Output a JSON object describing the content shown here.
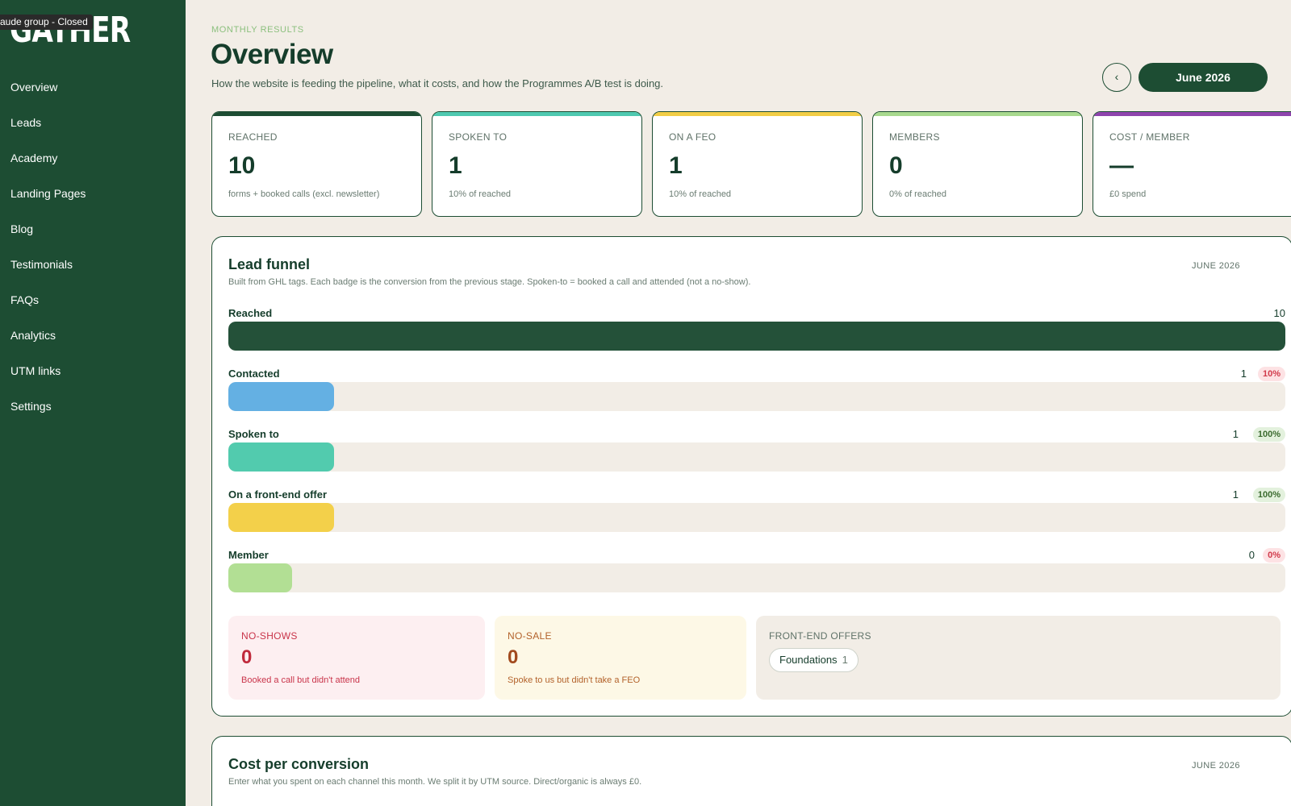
{
  "sidebar": {
    "logo": "GATHER",
    "tooltip": "aude group - Closed",
    "items": [
      "Overview",
      "Leads",
      "Academy",
      "Landing Pages",
      "Blog",
      "Testimonials",
      "FAQs",
      "Analytics",
      "UTM links",
      "Settings"
    ]
  },
  "header": {
    "eyebrow": "MONTHLY RESULTS",
    "title": "Overview",
    "subtitle": "How the website is feeding the pipeline, what it costs, and how the Programmes A/B test is doing.",
    "month": "June 2026",
    "prev_icon": "‹",
    "next_icon": "›"
  },
  "stats": [
    {
      "label": "REACHED",
      "value": "10",
      "note": "forms + booked calls (excl. newsletter)",
      "color": "#1d4d33"
    },
    {
      "label": "SPOKEN TO",
      "value": "1",
      "note": "10% of reached",
      "color": "#4fc9b0"
    },
    {
      "label": "ON A FEO",
      "value": "1",
      "note": "10% of reached",
      "color": "#f2cd46"
    },
    {
      "label": "MEMBERS",
      "value": "0",
      "note": "0% of reached",
      "color": "#a8d98e"
    },
    {
      "label": "COST / MEMBER",
      "value": "—",
      "note": "£0 spend",
      "color": "#8e44ad"
    }
  ],
  "funnel": {
    "title": "Lead funnel",
    "date": "JUNE 2026",
    "description": "Built from GHL tags. Each badge is the conversion from the previous stage. Spoken-to = booked a call and attended (not a no-show).",
    "stages": [
      {
        "name": "Reached",
        "count": "10",
        "badge": "",
        "fill": 1.0,
        "color": "#245139"
      },
      {
        "name": "Contacted",
        "count": "1",
        "badge": "10%",
        "badge_type": "bad",
        "fill": 0.1,
        "color": "#64b0e3"
      },
      {
        "name": "Spoken to",
        "count": "1",
        "badge": "100%",
        "badge_type": "good",
        "fill": 0.1,
        "color": "#52cbae"
      },
      {
        "name": "On a front-end offer",
        "count": "1",
        "badge": "100%",
        "badge_type": "good",
        "fill": 0.1,
        "color": "#f3d04a"
      },
      {
        "name": "Member",
        "count": "0",
        "badge": "0%",
        "badge_type": "bad",
        "fill": 0.06,
        "color": "#b2df94"
      }
    ],
    "no_shows": {
      "label": "NO-SHOWS",
      "value": "0",
      "note": "Booked a call but didn't attend"
    },
    "no_sale": {
      "label": "NO-SALE",
      "value": "0",
      "note": "Spoke to us but didn't take a FEO"
    },
    "front_end_offers": {
      "label": "FRONT-END OFFERS",
      "chips": [
        {
          "name": "Foundations",
          "count": "1"
        }
      ]
    }
  },
  "cost": {
    "title": "Cost per conversion",
    "date": "JUNE 2026",
    "description": "Enter what you spent on each channel this month. We split it by UTM source. Direct/organic is always £0."
  }
}
